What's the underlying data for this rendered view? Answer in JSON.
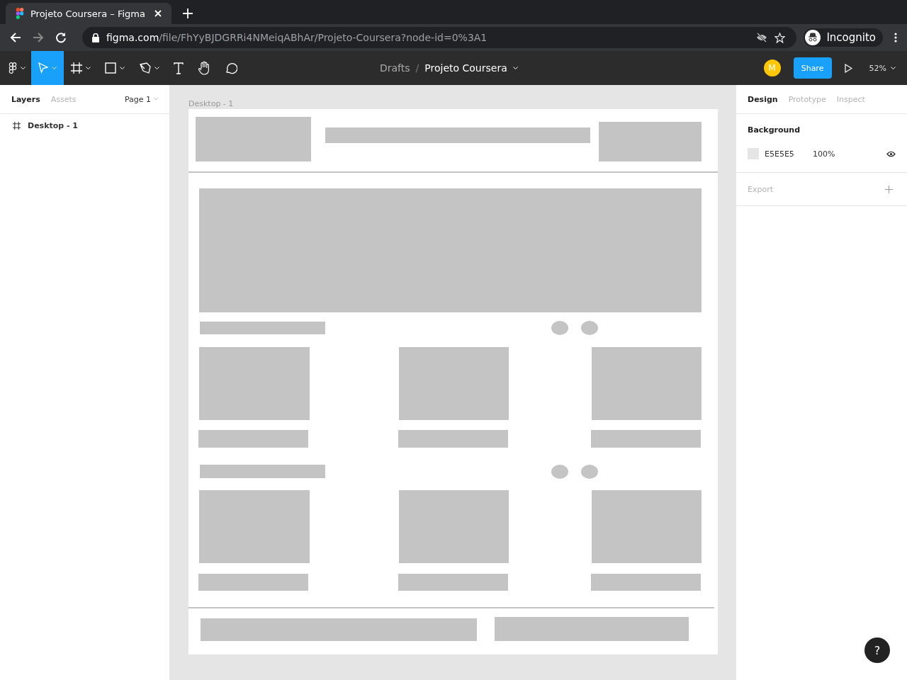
{
  "browser": {
    "tab_title": "Projeto Coursera – Figma",
    "url_host": "figma.com",
    "url_path": "/file/FhYyBJDGRRi4NMeiqABhAr/Projeto-Coursera?node-id=0%3A1",
    "profile": "Incognito"
  },
  "toolbar": {
    "tools": [
      {
        "kind": "menu",
        "selected": false
      },
      {
        "kind": "move",
        "selected": true
      },
      {
        "kind": "frame",
        "selected": false
      },
      {
        "kind": "shape",
        "selected": false
      },
      {
        "kind": "pen",
        "selected": false
      },
      {
        "kind": "text",
        "selected": false
      },
      {
        "kind": "hand",
        "selected": false
      },
      {
        "kind": "comment",
        "selected": false
      }
    ],
    "breadcrumb": "Drafts",
    "separator": "/",
    "file_name": "Projeto Coursera",
    "avatar": "M",
    "share": "Share",
    "zoom": "52%"
  },
  "left_panel": {
    "tabs": [
      {
        "label": "Layers",
        "selected": true
      },
      {
        "label": "Assets",
        "selected": false
      }
    ],
    "page": "Page 1",
    "layers": [
      {
        "name": "Desktop - 1"
      }
    ]
  },
  "canvas": {
    "frame_label": "Desktop - 1"
  },
  "right_panel": {
    "tabs": [
      {
        "label": "Design",
        "selected": true
      },
      {
        "label": "Prototype",
        "selected": false
      },
      {
        "label": "Inspect",
        "selected": false
      }
    ],
    "background": {
      "title": "Background",
      "color": "#e5e5e5",
      "hex": "E5E5E5",
      "opacity": "100%"
    },
    "export": "Export"
  },
  "help": "?"
}
